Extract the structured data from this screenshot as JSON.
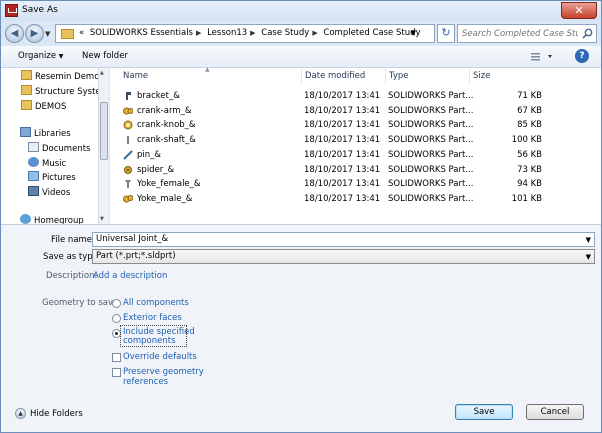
{
  "window": {
    "title": "Save As"
  },
  "address": {
    "breadcrumbs": [
      "SOLIDWORKS Essentials",
      "Lesson13",
      "Case Study",
      "Completed Case Study"
    ],
    "overflow": "«",
    "search_placeholder": "Search Completed Case Study"
  },
  "toolbar": {
    "organize": "Organize",
    "new_folder": "New folder"
  },
  "nav": {
    "folders": [
      "Resemin Demos",
      "Structure System",
      "DEMOS"
    ],
    "libraries_label": "Libraries",
    "libraries": [
      "Documents",
      "Music",
      "Pictures",
      "Videos"
    ],
    "homegroup": "Homegroup"
  },
  "files": {
    "headers": {
      "name": "Name",
      "date": "Date modified",
      "type": "Type",
      "size": "Size"
    },
    "rows": [
      {
        "name": "bracket_&",
        "date": "18/10/2017 13:41",
        "type": "SOLIDWORKS Part...",
        "size": "71 KB",
        "icon": "bracket-part"
      },
      {
        "name": "crank-arm_&",
        "date": "18/10/2017 13:41",
        "type": "SOLIDWORKS Part...",
        "size": "67 KB",
        "icon": "crank-arm-part"
      },
      {
        "name": "crank-knob_&",
        "date": "18/10/2017 13:41",
        "type": "SOLIDWORKS Part...",
        "size": "85 KB",
        "icon": "crank-knob-part"
      },
      {
        "name": "crank-shaft_&",
        "date": "18/10/2017 13:41",
        "type": "SOLIDWORKS Part...",
        "size": "100 KB",
        "icon": "crank-shaft-part"
      },
      {
        "name": "pin_&",
        "date": "18/10/2017 13:41",
        "type": "SOLIDWORKS Part...",
        "size": "56 KB",
        "icon": "pin-part"
      },
      {
        "name": "spider_&",
        "date": "18/10/2017 13:41",
        "type": "SOLIDWORKS Part...",
        "size": "73 KB",
        "icon": "spider-part"
      },
      {
        "name": "Yoke_female_&",
        "date": "18/10/2017 13:41",
        "type": "SOLIDWORKS Part...",
        "size": "94 KB",
        "icon": "yoke-female-part"
      },
      {
        "name": "Yoke_male_&",
        "date": "18/10/2017 13:41",
        "type": "SOLIDWORKS Part...",
        "size": "101 KB",
        "icon": "yoke-male-part"
      }
    ]
  },
  "form": {
    "file_name_label": "File name:",
    "file_name_value": "Universal Joint_&",
    "save_type_label": "Save as type:",
    "save_type_value": "Part (*.prt;*.sldprt)",
    "description_label": "Description:",
    "description_link": "Add a description",
    "geometry_label": "Geometry to save:",
    "opt_all": "All components",
    "opt_exterior": "Exterior faces",
    "opt_include_1": "Include specified",
    "opt_include_2": "components",
    "chk_override": "Override defaults",
    "chk_preserve_1": "Preserve geometry",
    "chk_preserve_2": "references",
    "selected_option": "include"
  },
  "buttons": {
    "hide_folders": "Hide Folders",
    "save": "Save",
    "cancel": "Cancel"
  },
  "colors": {
    "link": "#1f5db4",
    "folder": "#e8c25a",
    "part_icon": "#c89b1e"
  }
}
